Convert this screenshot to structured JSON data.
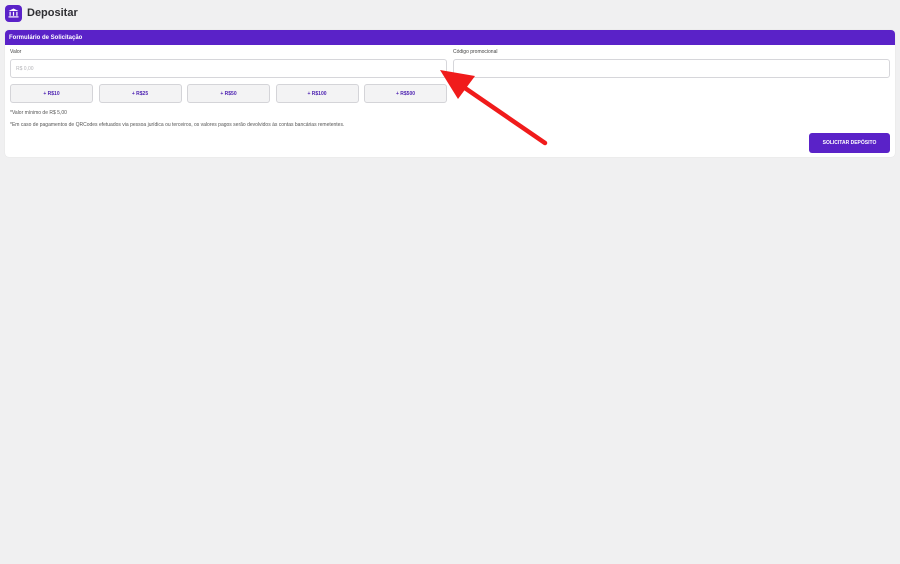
{
  "header": {
    "title": "Depositar",
    "icon": "bank-icon",
    "icon_color": "#5a22c8"
  },
  "form": {
    "section_title": "Formulário de Solicitação",
    "value_label": "Valor",
    "value_placeholder": "R$ 0,00",
    "promo_label": "Código promocional",
    "promo_value": "",
    "quick_amounts": [
      "+ R$10",
      "+ R$25",
      "+ R$50",
      "+ R$100",
      "+ R$500"
    ],
    "min_note": "*Valor mínimo de R$ 5,00",
    "refund_note": "*Em caso de pagamentos de QRCodes efetuados via pessoa jurídica ou terceiros, os valores pagos serão devolvidos às contas bancárias remetentes.",
    "submit_label": "SOLICITAR DEPÓSITO"
  },
  "colors": {
    "accent": "#5a22c8",
    "background": "#f0f0f1",
    "annotation_arrow": "#f01b1b"
  }
}
